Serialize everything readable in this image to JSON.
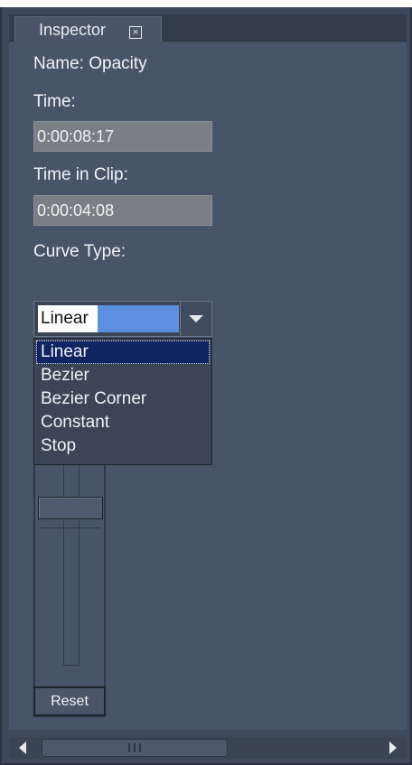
{
  "panel": {
    "tab_label": "Inspector",
    "name_label": "Name: Opacity",
    "time_label": "Time:",
    "time_value": "0:00:08:17",
    "time_in_clip_label": "Time in Clip:",
    "time_in_clip_value": "0:00:04:08",
    "curve_type_label": "Curve Type:",
    "curve_type_selected": "Linear",
    "curve_type_options": [
      "Linear",
      "Bezier",
      "Bezier Corner",
      "Constant",
      "Stop"
    ],
    "reset_label": "Reset"
  },
  "icons": {
    "tab_close": "close-box-icon",
    "dropdown": "chevron-down-icon",
    "scroll_left": "arrow-left-icon",
    "scroll_right": "arrow-right-icon"
  },
  "colors": {
    "panel_bg": "#485468",
    "selection_highlight": "#0f2461",
    "text_selection": "#5c8fe0",
    "field_bg": "#7b7e84"
  }
}
